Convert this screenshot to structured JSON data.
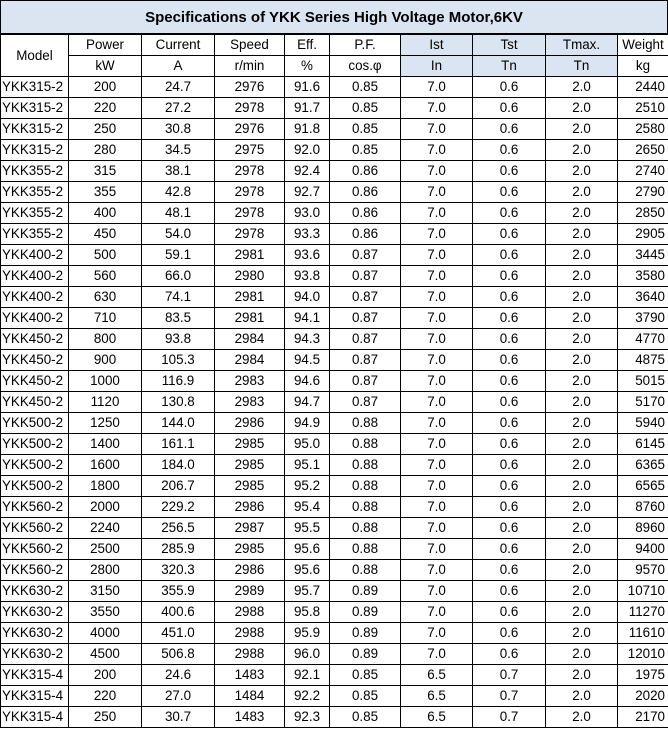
{
  "title": "Specifications of YKK Series High Voltage Motor,6KV",
  "header": {
    "model": "Model",
    "columns": [
      {
        "top": "Power",
        "bottom": "kW",
        "blue": false
      },
      {
        "top": "Current",
        "bottom": "A",
        "blue": false
      },
      {
        "top": "Speed",
        "bottom": "r/min",
        "blue": false
      },
      {
        "top": "Eff.",
        "bottom": "%",
        "blue": false
      },
      {
        "top": "P.F.",
        "bottom": "cos.φ",
        "blue": false
      },
      {
        "top": "Ist",
        "bottom": "In",
        "blue": true
      },
      {
        "top": "Tst",
        "bottom": "Tn",
        "blue": true
      },
      {
        "top": "Tmax.",
        "bottom": "Tn",
        "blue": true
      },
      {
        "top": "Weight",
        "bottom": "kg",
        "blue": false
      }
    ]
  },
  "rows": [
    [
      "YKK315-2",
      "200",
      "24.7",
      "2976",
      "91.6",
      "0.85",
      "7.0",
      "0.6",
      "2.0",
      "2440"
    ],
    [
      "YKK315-2",
      "220",
      "27.2",
      "2978",
      "91.7",
      "0.85",
      "7.0",
      "0.6",
      "2.0",
      "2510"
    ],
    [
      "YKK315-2",
      "250",
      "30.8",
      "2976",
      "91.8",
      "0.85",
      "7.0",
      "0.6",
      "2.0",
      "2580"
    ],
    [
      "YKK315-2",
      "280",
      "34.5",
      "2975",
      "92.0",
      "0.85",
      "7.0",
      "0.6",
      "2.0",
      "2650"
    ],
    [
      "YKK355-2",
      "315",
      "38.1",
      "2978",
      "92.4",
      "0.86",
      "7.0",
      "0.6",
      "2.0",
      "2740"
    ],
    [
      "YKK355-2",
      "355",
      "42.8",
      "2978",
      "92.7",
      "0.86",
      "7.0",
      "0.6",
      "2.0",
      "2790"
    ],
    [
      "YKK355-2",
      "400",
      "48.1",
      "2978",
      "93.0",
      "0.86",
      "7.0",
      "0.6",
      "2.0",
      "2850"
    ],
    [
      "YKK355-2",
      "450",
      "54.0",
      "2978",
      "93.3",
      "0.86",
      "7.0",
      "0.6",
      "2.0",
      "2905"
    ],
    [
      "YKK400-2",
      "500",
      "59.1",
      "2981",
      "93.6",
      "0.87",
      "7.0",
      "0.6",
      "2.0",
      "3445"
    ],
    [
      "YKK400-2",
      "560",
      "66.0",
      "2980",
      "93.8",
      "0.87",
      "7.0",
      "0.6",
      "2.0",
      "3580"
    ],
    [
      "YKK400-2",
      "630",
      "74.1",
      "2981",
      "94.0",
      "0.87",
      "7.0",
      "0.6",
      "2.0",
      "3640"
    ],
    [
      "YKK400-2",
      "710",
      "83.5",
      "2981",
      "94.1",
      "0.87",
      "7.0",
      "0.6",
      "2.0",
      "3790"
    ],
    [
      "YKK450-2",
      "800",
      "93.8",
      "2984",
      "94.3",
      "0.87",
      "7.0",
      "0.6",
      "2.0",
      "4770"
    ],
    [
      "YKK450-2",
      "900",
      "105.3",
      "2984",
      "94.5",
      "0.87",
      "7.0",
      "0.6",
      "2.0",
      "4875"
    ],
    [
      "YKK450-2",
      "1000",
      "116.9",
      "2983",
      "94.6",
      "0.87",
      "7.0",
      "0.6",
      "2.0",
      "5015"
    ],
    [
      "YKK450-2",
      "1120",
      "130.8",
      "2983",
      "94.7",
      "0.87",
      "7.0",
      "0.6",
      "2.0",
      "5170"
    ],
    [
      "YKK500-2",
      "1250",
      "144.0",
      "2986",
      "94.9",
      "0.88",
      "7.0",
      "0.6",
      "2.0",
      "5940"
    ],
    [
      "YKK500-2",
      "1400",
      "161.1",
      "2985",
      "95.0",
      "0.88",
      "7.0",
      "0.6",
      "2.0",
      "6145"
    ],
    [
      "YKK500-2",
      "1600",
      "184.0",
      "2985",
      "95.1",
      "0.88",
      "7.0",
      "0.6",
      "2.0",
      "6365"
    ],
    [
      "YKK500-2",
      "1800",
      "206.7",
      "2985",
      "95.2",
      "0.88",
      "7.0",
      "0.6",
      "2.0",
      "6565"
    ],
    [
      "YKK560-2",
      "2000",
      "229.2",
      "2986",
      "95.4",
      "0.88",
      "7.0",
      "0.6",
      "2.0",
      "8760"
    ],
    [
      "YKK560-2",
      "2240",
      "256.5",
      "2987",
      "95.5",
      "0.88",
      "7.0",
      "0.6",
      "2.0",
      "8960"
    ],
    [
      "YKK560-2",
      "2500",
      "285.9",
      "2985",
      "95.6",
      "0.88",
      "7.0",
      "0.6",
      "2.0",
      "9400"
    ],
    [
      "YKK560-2",
      "2800",
      "320.3",
      "2986",
      "95.6",
      "0.88",
      "7.0",
      "0.6",
      "2.0",
      "9570"
    ],
    [
      "YKK630-2",
      "3150",
      "355.9",
      "2989",
      "95.7",
      "0.89",
      "7.0",
      "0.6",
      "2.0",
      "10710"
    ],
    [
      "YKK630-2",
      "3550",
      "400.6",
      "2988",
      "95.8",
      "0.89",
      "7.0",
      "0.6",
      "2.0",
      "11270"
    ],
    [
      "YKK630-2",
      "4000",
      "451.0",
      "2988",
      "95.9",
      "0.89",
      "7.0",
      "0.6",
      "2.0",
      "11610"
    ],
    [
      "YKK630-2",
      "4500",
      "506.8",
      "2988",
      "96.0",
      "0.89",
      "7.0",
      "0.6",
      "2.0",
      "12010"
    ],
    [
      "YKK315-4",
      "200",
      "24.6",
      "1483",
      "92.1",
      "0.85",
      "6.5",
      "0.7",
      "2.0",
      "1975"
    ],
    [
      "YKK315-4",
      "220",
      "27.0",
      "1484",
      "92.2",
      "0.85",
      "6.5",
      "0.7",
      "2.0",
      "2020"
    ],
    [
      "YKK315-4",
      "250",
      "30.7",
      "1483",
      "92.3",
      "0.85",
      "6.5",
      "0.7",
      "2.0",
      "2170"
    ]
  ],
  "colors": {
    "header_blue": "#dbe5f1",
    "border": "#000000"
  }
}
